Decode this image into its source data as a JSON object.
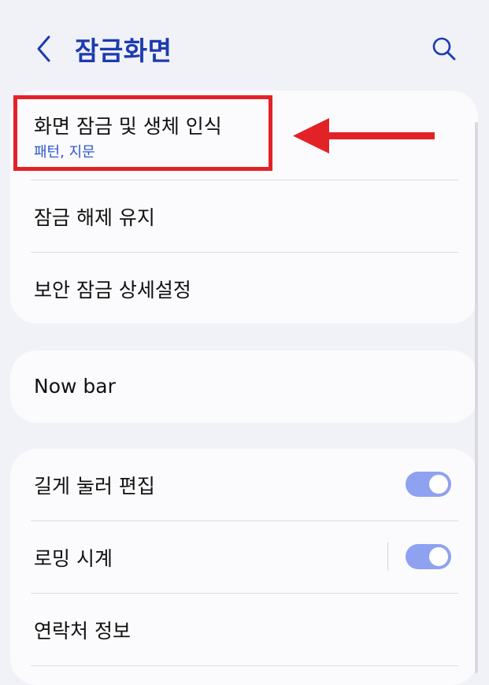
{
  "header": {
    "title": "잠금화면",
    "back_icon": "chevron-left-icon",
    "search_icon": "search-icon",
    "accent_color": "#1c3bb0"
  },
  "groups": [
    {
      "items": [
        {
          "title": "화면 잠금 및 생체 인식",
          "subtitle": "패턴, 지문"
        },
        {
          "title": "잠금 해제 유지"
        },
        {
          "title": "보안 잠금 상세설정"
        }
      ]
    },
    {
      "items": [
        {
          "title": "Now bar"
        }
      ]
    },
    {
      "items": [
        {
          "title": "길게 눌러 편집",
          "toggle_on": true
        },
        {
          "title": "로밍 시계",
          "toggle_on": true
        },
        {
          "title": "연락처 정보"
        }
      ]
    }
  ],
  "annotation": {
    "highlight_color": "#e32228",
    "arrow_icon": "left-arrow-icon"
  },
  "colors": {
    "background": "#f1f1f8",
    "card": "#fbfbfd",
    "subtitle": "#2c55cf",
    "toggle_on": "#8fa1f1"
  }
}
